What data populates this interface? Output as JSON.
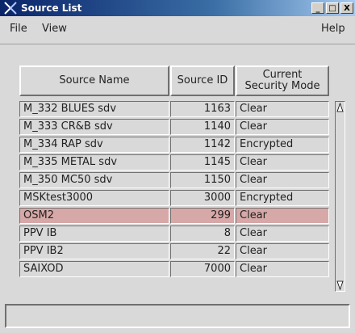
{
  "window": {
    "title": "Source List",
    "buttons": [
      "_",
      "□",
      "X"
    ]
  },
  "menu": {
    "file": "File",
    "view": "View",
    "help": "Help"
  },
  "table": {
    "columns": {
      "name": "Source Name",
      "id": "Source ID",
      "mode": "Current Security Mode"
    },
    "rows": [
      {
        "name": "M_332 BLUES sdv",
        "id": "1163",
        "mode": "Clear"
      },
      {
        "name": "M_333 CR&B sdv",
        "id": "1140",
        "mode": "Clear"
      },
      {
        "name": "M_334 RAP sdv",
        "id": "1142",
        "mode": "Encrypted"
      },
      {
        "name": "M_335 METAL sdv",
        "id": "1145",
        "mode": "Clear"
      },
      {
        "name": "M_350 MC50 sdv",
        "id": "1150",
        "mode": "Clear"
      },
      {
        "name": "MSKtest3000",
        "id": "3000",
        "mode": "Encrypted"
      },
      {
        "name": "OSM2",
        "id": "299",
        "mode": "Clear"
      },
      {
        "name": "PPV IB",
        "id": "8",
        "mode": "Clear"
      },
      {
        "name": "PPV IB2",
        "id": "22",
        "mode": "Clear"
      },
      {
        "name": "SAIXOD",
        "id": "7000",
        "mode": "Clear"
      }
    ],
    "selected_index": 6
  },
  "status": {
    "text": ""
  },
  "colors": {
    "title_bar": "#0a246a",
    "selected_row": "#d7a8a8",
    "background": "#d9d9d9"
  }
}
